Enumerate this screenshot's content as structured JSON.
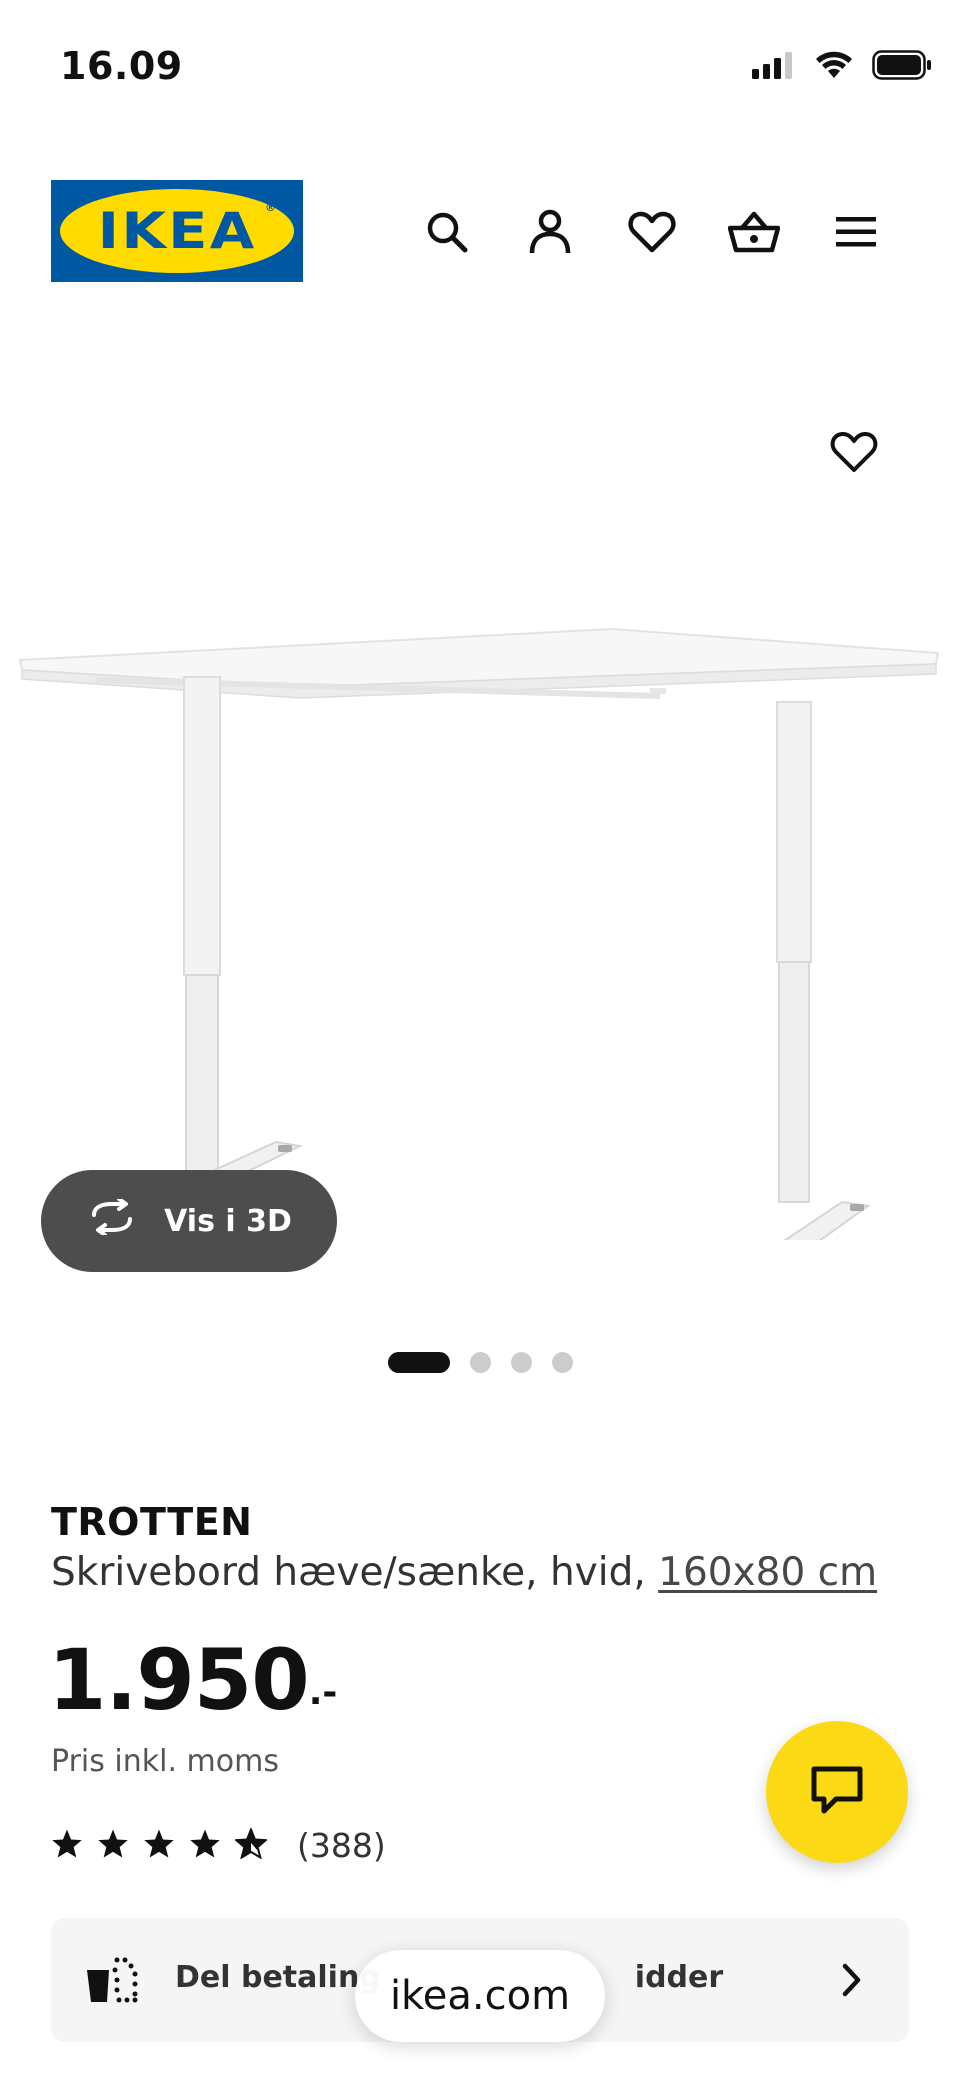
{
  "status_bar": {
    "time": "16.09"
  },
  "header": {
    "logo_text": "IKEA",
    "logo_reg": "®",
    "icons": [
      "search-icon",
      "account-icon",
      "favorites-heart-icon",
      "shopping-basket-icon",
      "menu-icon"
    ]
  },
  "gallery": {
    "view_3d_label": "Vis i 3D",
    "page_count": 4,
    "active_page": 1
  },
  "product": {
    "name": "TROTTEN",
    "description": "Skrivebord hæve/sænke, hvid, ",
    "size": "160x80 cm",
    "price": "1.950",
    "price_suffix": ".-",
    "price_note": "Pris inkl. moms",
    "rating_stars": 4.5,
    "rating_count": "(388)"
  },
  "pay_banner": {
    "label": "Del betaling",
    "trailing_text": "idder"
  },
  "browser": {
    "url": "ikea.com"
  },
  "colors": {
    "ikea_blue": "#0058a3",
    "ikea_yellow": "#ffdb00",
    "chat_yellow": "#fbd914",
    "dark_button": "#4d4d4d"
  }
}
